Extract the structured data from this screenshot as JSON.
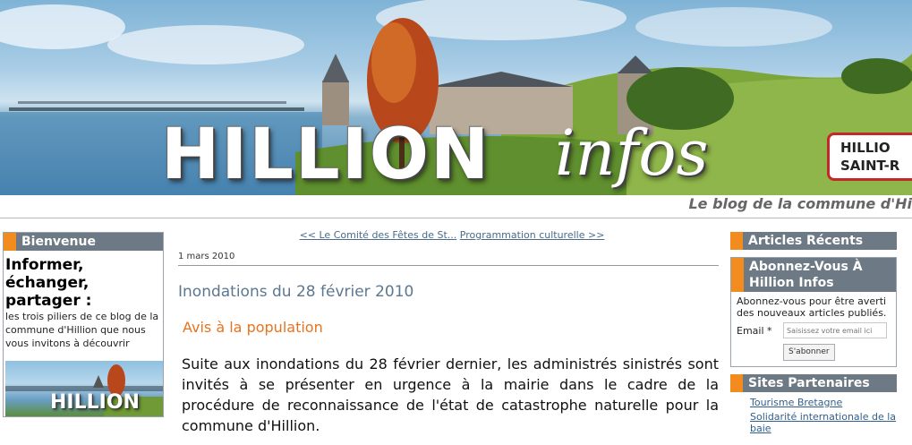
{
  "header": {
    "title": "HILLION",
    "title_suffix": "infos",
    "sign_line1": "HILLIO",
    "sign_line2": "SAINT-R",
    "tagline": "Le blog de la commune d'Hi"
  },
  "left_sidebar": {
    "welcome": {
      "heading": "Bienvenue",
      "title": "Informer, échanger, partager :",
      "text": "les trois piliers de ce blog de la commune d'Hillion que nous vous invitons à découvrir",
      "image_text": "HILLION"
    }
  },
  "post": {
    "nav_prev": "<< Le Comité des Fêtes de St...",
    "nav_next": "Programmation culturelle >>",
    "date": "1 mars 2010",
    "title": "Inondations du 28 février 2010",
    "subtitle": "Avis à la population",
    "body": "Suite aux inondations du 28 février dernier, les administrés sinistrés sont invités à se présenter en urgence à la mairie dans le cadre de la procédure de reconnaissance de l'état de catastrophe naturelle pour la commune d'Hillion."
  },
  "right_sidebar": {
    "recent": {
      "heading": "Articles Récents"
    },
    "subscribe": {
      "heading": "Abonnez-Vous À Hillion Infos",
      "text": "Abonnez-vous pour être averti des nouveaux articles publiés.",
      "email_label": "Email *",
      "email_placeholder": "Saisissez votre email ici",
      "button_label": "S'abonner"
    },
    "partners": {
      "heading": "Sites Partenaires",
      "links": [
        "Tourisme Bretagne",
        "Solidarité internationale de la baie"
      ]
    }
  },
  "colors": {
    "accent_orange": "#f28c1e",
    "box_header": "#6d7a85",
    "title_blue": "#5c7791",
    "subtitle_orange": "#e8731e"
  }
}
